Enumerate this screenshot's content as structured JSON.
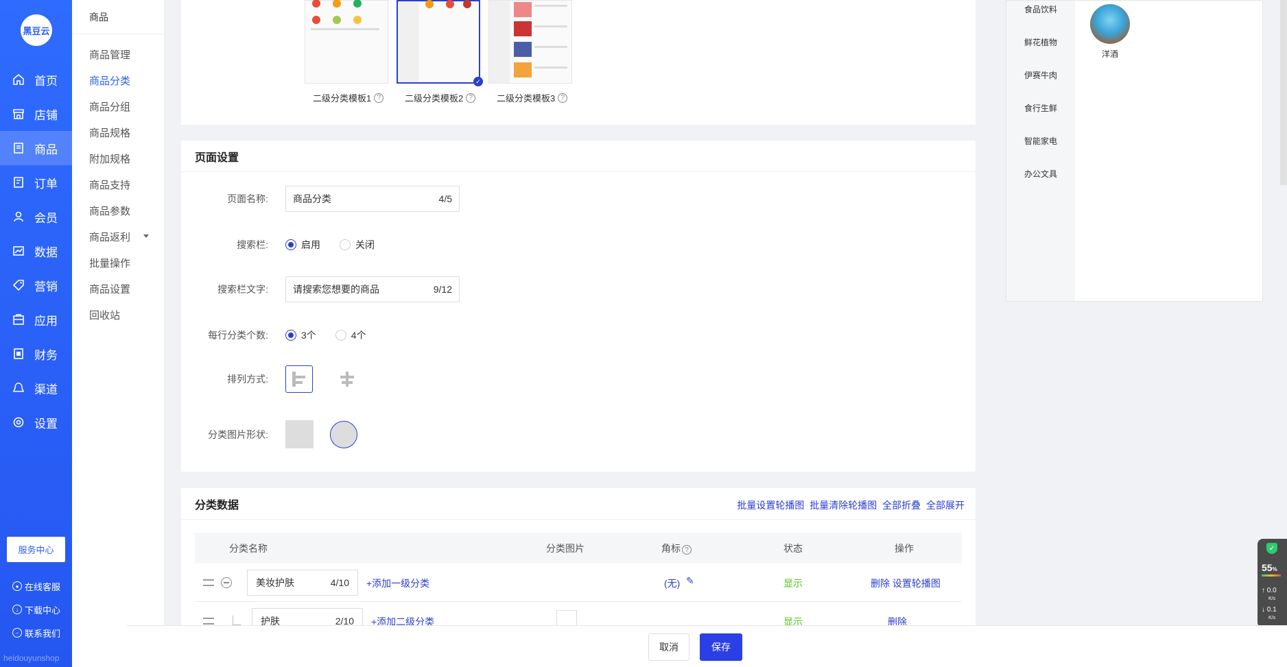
{
  "brand": {
    "logo_text": "黑豆云",
    "domain": "heidouyunshop"
  },
  "nav": {
    "items": [
      {
        "label": "首页",
        "icon": "home-icon"
      },
      {
        "label": "店铺",
        "icon": "store-icon"
      },
      {
        "label": "商品",
        "icon": "goods-icon",
        "active": true
      },
      {
        "label": "订单",
        "icon": "order-icon"
      },
      {
        "label": "会员",
        "icon": "user-icon"
      },
      {
        "label": "数据",
        "icon": "chart-icon"
      },
      {
        "label": "营销",
        "icon": "tag-icon"
      },
      {
        "label": "应用",
        "icon": "app-icon"
      },
      {
        "label": "财务",
        "icon": "finance-icon"
      },
      {
        "label": "渠道",
        "icon": "channel-icon"
      },
      {
        "label": "设置",
        "icon": "gear-icon"
      }
    ],
    "service_center": "服务中心",
    "links": [
      "在线客服",
      "下载中心",
      "联系我们"
    ]
  },
  "submenu": {
    "title": "商品",
    "items": [
      "商品管理",
      "商品分类",
      "商品分组",
      "商品规格",
      "附加规格",
      "商品支持",
      "商品参数",
      "商品返利",
      "批量操作",
      "商品设置",
      "回收站"
    ],
    "active_index": 1
  },
  "templates": {
    "items": [
      {
        "label": "二级分类模板1"
      },
      {
        "label": "二级分类模板2",
        "selected": true
      },
      {
        "label": "二级分类模板3"
      }
    ]
  },
  "page_settings": {
    "title": "页面设置",
    "page_name": {
      "label": "页面名称:",
      "value": "商品分类",
      "count": "4/5"
    },
    "search_bar": {
      "label": "搜索栏:",
      "options": [
        "启用",
        "关闭"
      ],
      "selected": "启用"
    },
    "search_text": {
      "label": "搜索栏文字:",
      "value": "请搜索您想要的商品",
      "count": "9/12"
    },
    "per_row": {
      "label": "每行分类个数:",
      "options": [
        "3个",
        "4个"
      ],
      "selected": "3个"
    },
    "arrange": {
      "label": "排列方式:"
    },
    "image_shape": {
      "label": "分类图片形状:"
    }
  },
  "category_data": {
    "title": "分类数据",
    "actions": [
      "批量设置轮播图",
      "批量清除轮播图",
      "全部折叠",
      "全部展开"
    ],
    "columns": [
      "分类名称",
      "分类图片",
      "角标",
      "状态",
      "操作"
    ],
    "rows": [
      {
        "name": "美妆护肤",
        "count": "4/10",
        "add_link": "+添加一级分类",
        "badge": "(无)",
        "status": "显示",
        "ops": "删除 设置轮播图"
      },
      {
        "name": "护肤",
        "count": "2/10",
        "add_link": "+添加二级分类",
        "status": "显示",
        "ops": "删除"
      }
    ]
  },
  "preview": {
    "categories": [
      "食品饮料",
      "鲜花植物",
      "伊赛牛肉",
      "食行生鲜",
      "智能家电",
      "办公文具"
    ],
    "product_name": "洋酒"
  },
  "speed_widget": {
    "percent": "55",
    "percent_unit": "%",
    "up": "0.0",
    "down": "0.1",
    "unit": "K/s"
  },
  "footer": {
    "cancel": "取消",
    "save": "保存"
  },
  "colors": {
    "primary": "#2a5ff5",
    "accent": "#2a3fcf",
    "success": "#52c41a"
  }
}
